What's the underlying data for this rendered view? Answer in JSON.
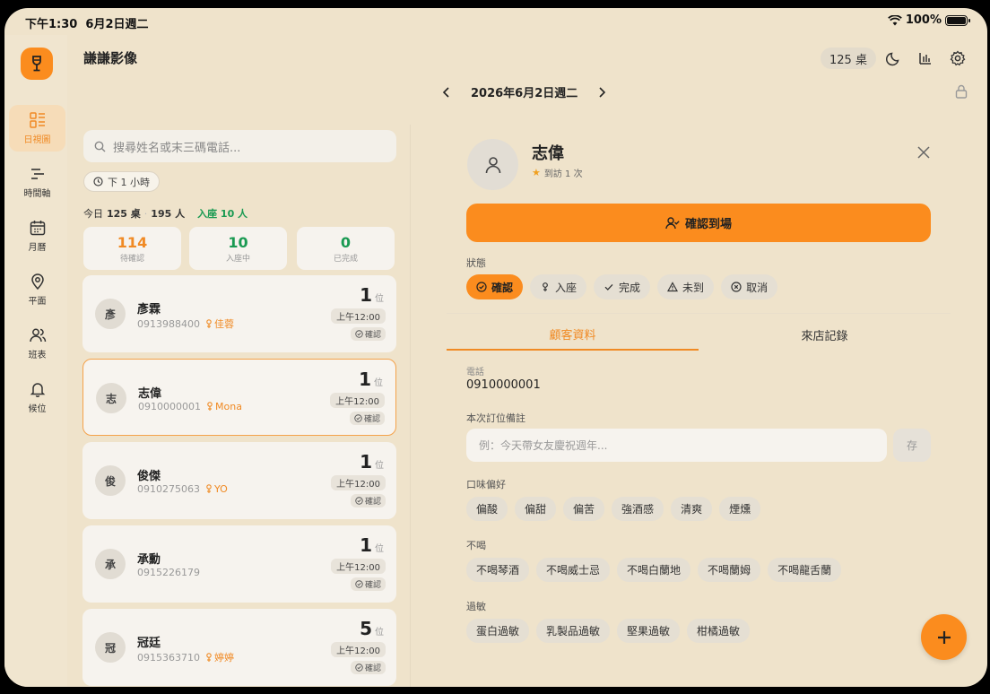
{
  "status_bar": {
    "time": "下午1:30",
    "date": "6月2日週二",
    "battery": "100%",
    "battery_level": 1.0
  },
  "app": {
    "brand": "謙謙影像",
    "table_count": "125 桌"
  },
  "nav": [
    {
      "label": "日視圖",
      "icon": "day-view-icon",
      "active": true
    },
    {
      "label": "時間軸",
      "icon": "timeline-icon",
      "active": false
    },
    {
      "label": "月曆",
      "icon": "calendar-icon",
      "active": false
    },
    {
      "label": "平面",
      "icon": "map-pin-icon",
      "active": false
    },
    {
      "label": "班表",
      "icon": "users-icon",
      "active": false
    },
    {
      "label": "候位",
      "icon": "bell-icon",
      "active": false
    }
  ],
  "date_nav": {
    "date": "2026年6月2日週二"
  },
  "search": {
    "placeholder": "搜尋姓名或末三碼電話..."
  },
  "filter": {
    "label": "下 1 小時"
  },
  "summary": {
    "today": "今日",
    "tables": "125 桌",
    "people": "195 人",
    "seated": "入座 10 人"
  },
  "stats": [
    {
      "value": "114",
      "label": "待確認",
      "color": "#f08a24"
    },
    {
      "value": "10",
      "label": "入座中",
      "color": "#1a9a52"
    },
    {
      "value": "0",
      "label": "已完成",
      "color": "#1a9a52"
    }
  ],
  "reservations": [
    {
      "initial": "彥",
      "name": "彥霖",
      "phone": "0913988400",
      "staff": "佳蓉",
      "party": "1",
      "unit": "位",
      "time": "上午12:00",
      "status": "確認",
      "selected": false
    },
    {
      "initial": "志",
      "name": "志偉",
      "phone": "0910000001",
      "staff": "Mona",
      "party": "1",
      "unit": "位",
      "time": "上午12:00",
      "status": "確認",
      "selected": true
    },
    {
      "initial": "俊",
      "name": "俊傑",
      "phone": "0910275063",
      "staff": "YO",
      "party": "1",
      "unit": "位",
      "time": "上午12:00",
      "status": "確認",
      "selected": false
    },
    {
      "initial": "承",
      "name": "承勳",
      "phone": "0915226179",
      "staff": "",
      "party": "1",
      "unit": "位",
      "time": "上午12:00",
      "status": "確認",
      "selected": false
    },
    {
      "initial": "冠",
      "name": "冠廷",
      "phone": "0915363710",
      "staff": "婷婷",
      "party": "5",
      "unit": "位",
      "time": "上午12:00",
      "status": "確認",
      "selected": false
    }
  ],
  "detail": {
    "name": "志偉",
    "visits": "到訪 1 次",
    "checkin_label": "確認到場",
    "status_label": "狀態",
    "status_options": [
      {
        "label": "確認",
        "icon": "check-circle-icon",
        "active": true
      },
      {
        "label": "入座",
        "icon": "seat-icon",
        "active": false
      },
      {
        "label": "完成",
        "icon": "check-icon",
        "active": false
      },
      {
        "label": "未到",
        "icon": "warning-icon",
        "active": false
      },
      {
        "label": "取消",
        "icon": "x-circle-icon",
        "active": false
      }
    ],
    "tabs": [
      {
        "label": "顧客資料",
        "active": true
      },
      {
        "label": "來店記錄",
        "active": false
      }
    ],
    "phone_label": "電話",
    "phone": "0910000001",
    "note_label": "本次訂位備註",
    "note_placeholder": "例：今天帶女友慶祝週年...",
    "save_label": "存",
    "taste_label": "口味偏好",
    "taste": [
      "偏酸",
      "偏甜",
      "偏苦",
      "強酒感",
      "清爽",
      "煙燻"
    ],
    "nodrink_label": "不喝",
    "nodrink": [
      "不喝琴酒",
      "不喝威士忌",
      "不喝白蘭地",
      "不喝蘭姆",
      "不喝龍舌蘭"
    ],
    "allergy_label": "過敏",
    "allergy": [
      "蛋白過敏",
      "乳製品過敏",
      "堅果過敏",
      "柑橘過敏"
    ]
  },
  "colors": {
    "accent": "#fb8c1e",
    "background": "#efe3cb",
    "green": "#1a9a52"
  }
}
